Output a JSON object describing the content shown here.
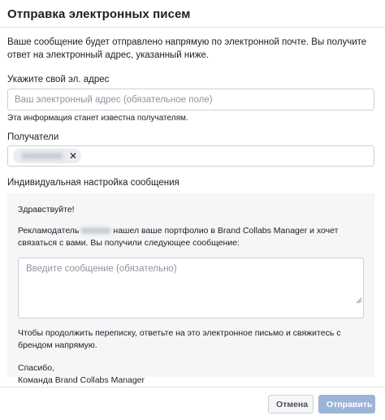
{
  "dialog": {
    "title": "Отправка электронных писем",
    "intro": "Ваше сообщение будет отправлено напрямую по электронной почте. Вы получите ответ на электронный адрес, указанный ниже."
  },
  "email": {
    "label": "Укажите свой эл. адрес",
    "placeholder": "Ваш электронный адрес (обязательное поле)",
    "hint": "Эта информация станет известна получателям."
  },
  "recipients": {
    "label": "Получатели",
    "remove_glyph": "✕"
  },
  "custom_message": {
    "label": "Индивидуальная настройка сообщения",
    "greeting": "Здравствуйте!",
    "advertiser_prefix": "Рекламодатель",
    "advertiser_suffix": "нашел ваше портфолио в Brand Collabs Manager и хочет связаться с вами. Вы получили следующее сообщение:",
    "message_placeholder": "Введите сообщение (обязательно)",
    "continue_text": "Чтобы продолжить переписку, ответьте на это электронное письмо и свяжитесь с брендом напрямую.",
    "signoff_line1": "Спасибо,",
    "signoff_line2": "Команда Brand Collabs Manager"
  },
  "footer": {
    "cancel_label": "Отмена",
    "send_label": "Отправить"
  },
  "colors": {
    "send_disabled": "#9cb4d8",
    "panel_bg": "#f5f6f7",
    "border": "#ccd0d5"
  }
}
